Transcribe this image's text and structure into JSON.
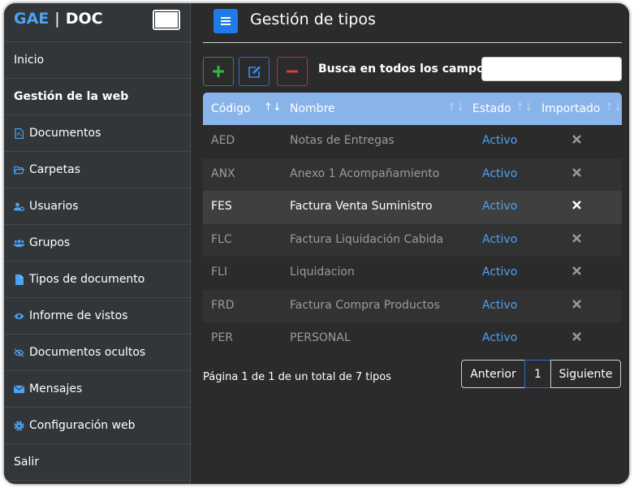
{
  "brand": {
    "left": "GAE",
    "separator": "|",
    "right": "DOC"
  },
  "sidebar": {
    "items": [
      {
        "label": "Inicio",
        "icon": "none"
      },
      {
        "label": "Gestión de la web",
        "icon": "none"
      },
      {
        "label": "Documentos",
        "icon": "pdf-file-icon"
      },
      {
        "label": "Carpetas",
        "icon": "folder-open-icon"
      },
      {
        "label": "Usuarios",
        "icon": "user-cog-icon"
      },
      {
        "label": "Grupos",
        "icon": "users-icon"
      },
      {
        "label": "Tipos de documento",
        "icon": "file-icon"
      },
      {
        "label": "Informe de vistos",
        "icon": "eye-icon"
      },
      {
        "label": "Documentos ocultos",
        "icon": "eye-slash-icon"
      },
      {
        "label": "Mensajes",
        "icon": "envelope-icon"
      },
      {
        "label": "Configuración web",
        "icon": "gear-icon"
      },
      {
        "label": "Salir",
        "icon": "none"
      }
    ]
  },
  "header": {
    "title": "Gestión de tipos"
  },
  "toolbar": {
    "search_label": "Busca en todos los campos:",
    "search_value": ""
  },
  "table": {
    "columns": [
      "Código",
      "Nombre",
      "Estado",
      "Importado"
    ],
    "rows": [
      {
        "codigo": "AED",
        "nombre": "Notas de Entregas",
        "estado": "Activo"
      },
      {
        "codigo": "ANX",
        "nombre": "Anexo 1 Acompañamiento",
        "estado": "Activo"
      },
      {
        "codigo": "FES",
        "nombre": "Factura Venta Suministro",
        "estado": "Activo"
      },
      {
        "codigo": "FLC",
        "nombre": "Factura Liquidación Cabida",
        "estado": "Activo"
      },
      {
        "codigo": "FLI",
        "nombre": "Liquidacion",
        "estado": "Activo"
      },
      {
        "codigo": "FRD",
        "nombre": "Factura Compra Productos",
        "estado": "Activo"
      },
      {
        "codigo": "PER",
        "nombre": "PERSONAL",
        "estado": "Activo"
      }
    ]
  },
  "footer": {
    "summary": "Página 1 de 1 de un total de 7 tipos"
  },
  "pager": {
    "prev": "Anterior",
    "page": "1",
    "next": "Siguiente"
  },
  "colors": {
    "accent": "#1e7be8",
    "header_row": "#89b4ea",
    "link": "#4aa3f5",
    "sidebar": "#333638",
    "main": "#2b2b2b"
  }
}
